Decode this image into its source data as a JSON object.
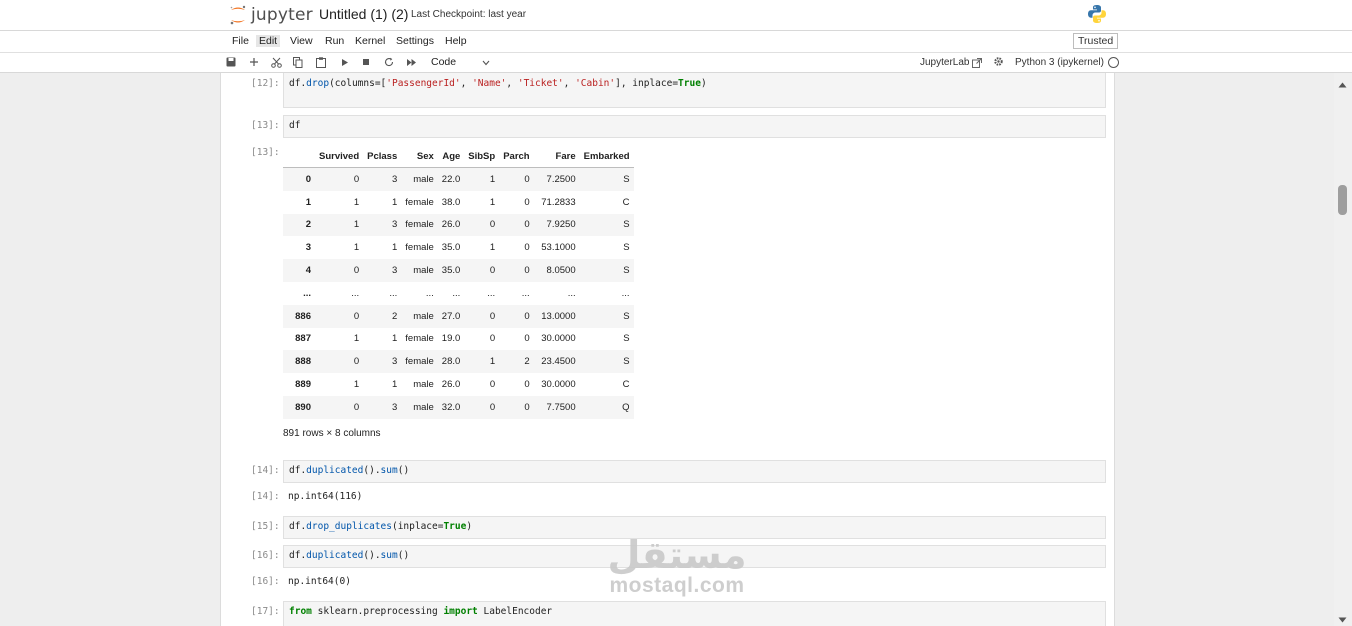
{
  "header": {
    "logo_text": "jupyter",
    "notebook_title": "Untitled (1) (2)",
    "checkpoint": "Last Checkpoint: last year",
    "trusted": "Trusted"
  },
  "menu": [
    "File",
    "Edit",
    "View",
    "Run",
    "Kernel",
    "Settings",
    "Help"
  ],
  "menu_active": "Edit",
  "toolbar": {
    "cell_type": "Code",
    "jupyterlab_label": "JupyterLab",
    "kernel_name": "Python 3 (ipykernel)"
  },
  "cells": {
    "c12": {
      "prompt": "[12]:",
      "code": {
        "p1": "df.",
        "fn": "drop",
        "p2": "(columns=[",
        "s1": "'PassengerId'",
        "p3": ", ",
        "s2": "'Name'",
        "p4": ", ",
        "s3": "'Ticket'",
        "p5": ", ",
        "s4": "'Cabin'",
        "p6": "], inplace=",
        "kw": "True",
        "p7": ")"
      }
    },
    "c13": {
      "prompt": "[13]:",
      "code": "df",
      "out_prompt": "[13]:"
    },
    "c14": {
      "prompt": "[14]:",
      "code": {
        "p1": "df.",
        "fn1": "duplicated",
        "p2": "().",
        "fn2": "sum",
        "p3": "()"
      },
      "out_prompt": "[14]:",
      "output": "np.int64(116)"
    },
    "c15": {
      "prompt": "[15]:",
      "code": {
        "p1": "df.",
        "fn": "drop_duplicates",
        "p2": "(inplace=",
        "kw": "True",
        "p3": ")"
      }
    },
    "c16": {
      "prompt": "[16]:",
      "code": {
        "p1": "df.",
        "fn1": "duplicated",
        "p2": "().",
        "fn2": "sum",
        "p3": "()"
      },
      "out_prompt": "[16]:",
      "output": "np.int64(0)"
    },
    "c17": {
      "prompt": "[17]:",
      "code": {
        "kw1": "from",
        "p1": " sklearn.preprocessing ",
        "kw2": "import",
        "p2": " LabelEncoder"
      }
    }
  },
  "dataframe": {
    "columns": [
      "",
      "Survived",
      "Pclass",
      "Sex",
      "Age",
      "SibSp",
      "Parch",
      "Fare",
      "Embarked"
    ],
    "rows": [
      [
        "0",
        "0",
        "3",
        "male",
        "22.0",
        "1",
        "0",
        "7.2500",
        "S"
      ],
      [
        "1",
        "1",
        "1",
        "female",
        "38.0",
        "1",
        "0",
        "71.2833",
        "C"
      ],
      [
        "2",
        "1",
        "3",
        "female",
        "26.0",
        "0",
        "0",
        "7.9250",
        "S"
      ],
      [
        "3",
        "1",
        "1",
        "female",
        "35.0",
        "1",
        "0",
        "53.1000",
        "S"
      ],
      [
        "4",
        "0",
        "3",
        "male",
        "35.0",
        "0",
        "0",
        "8.0500",
        "S"
      ],
      [
        "...",
        "...",
        "...",
        "...",
        "...",
        "...",
        "...",
        "...",
        "..."
      ],
      [
        "886",
        "0",
        "2",
        "male",
        "27.0",
        "0",
        "0",
        "13.0000",
        "S"
      ],
      [
        "887",
        "1",
        "1",
        "female",
        "19.0",
        "0",
        "0",
        "30.0000",
        "S"
      ],
      [
        "888",
        "0",
        "3",
        "female",
        "28.0",
        "1",
        "2",
        "23.4500",
        "S"
      ],
      [
        "889",
        "1",
        "1",
        "male",
        "26.0",
        "0",
        "0",
        "30.0000",
        "C"
      ],
      [
        "890",
        "0",
        "3",
        "male",
        "32.0",
        "0",
        "0",
        "7.7500",
        "Q"
      ]
    ],
    "footer": "891 rows × 8 columns"
  },
  "watermark": {
    "arabic": "مستقل",
    "latin": "mostaql.com"
  },
  "colors": {
    "string": "#ba2121",
    "keyword": "#008000",
    "function": "#0055aa",
    "logo_orange": "#f37726"
  }
}
